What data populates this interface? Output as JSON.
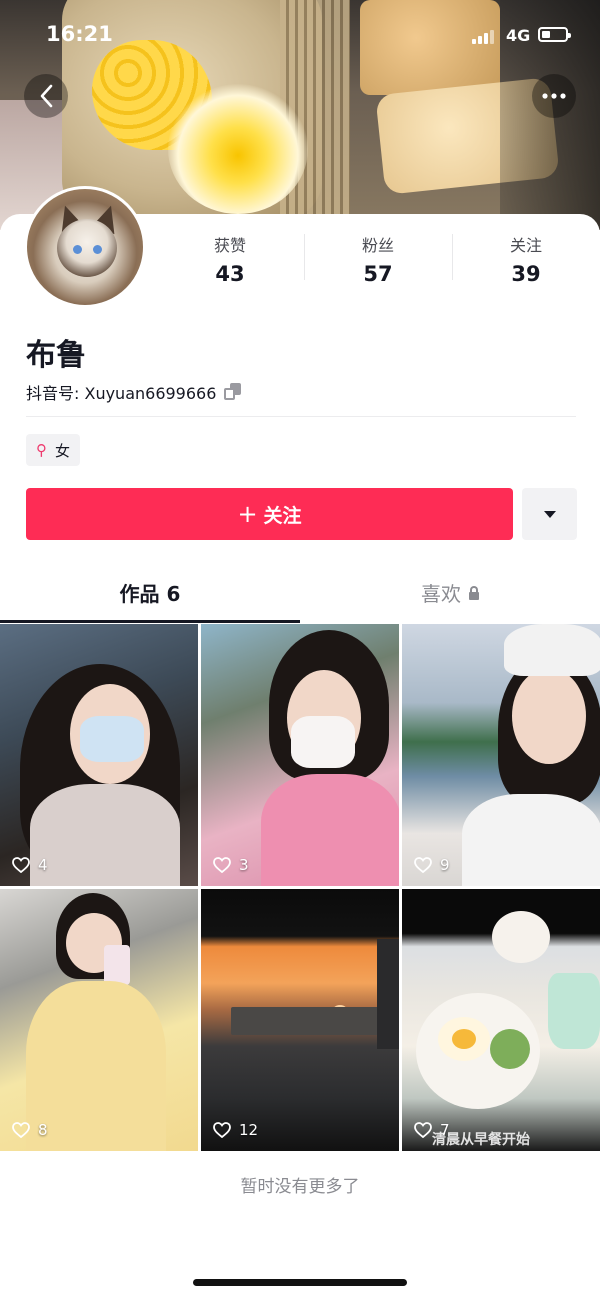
{
  "status_bar": {
    "time": "16:21",
    "network": "4G"
  },
  "profile": {
    "stats": [
      {
        "label": "获赞",
        "value": "43"
      },
      {
        "label": "粉丝",
        "value": "57"
      },
      {
        "label": "关注",
        "value": "39"
      }
    ],
    "name": "布鲁",
    "douyin_id": "抖音号: Xuyuan6699666",
    "gender": "女"
  },
  "actions": {
    "follow_label": "关注"
  },
  "tabs": [
    {
      "label": "作品 6",
      "active": true
    },
    {
      "label": "喜欢",
      "locked": true
    }
  ],
  "videos": [
    {
      "likes": "4"
    },
    {
      "likes": "3"
    },
    {
      "likes": "9"
    },
    {
      "likes": "8"
    },
    {
      "likes": "12"
    },
    {
      "likes": "7",
      "caption": "清晨从早餐开始"
    }
  ],
  "footer": {
    "text": "暂时没有更多了"
  },
  "colors": {
    "accent": "#fe2c55",
    "text": "#161823",
    "muted": "#8a8b91"
  }
}
